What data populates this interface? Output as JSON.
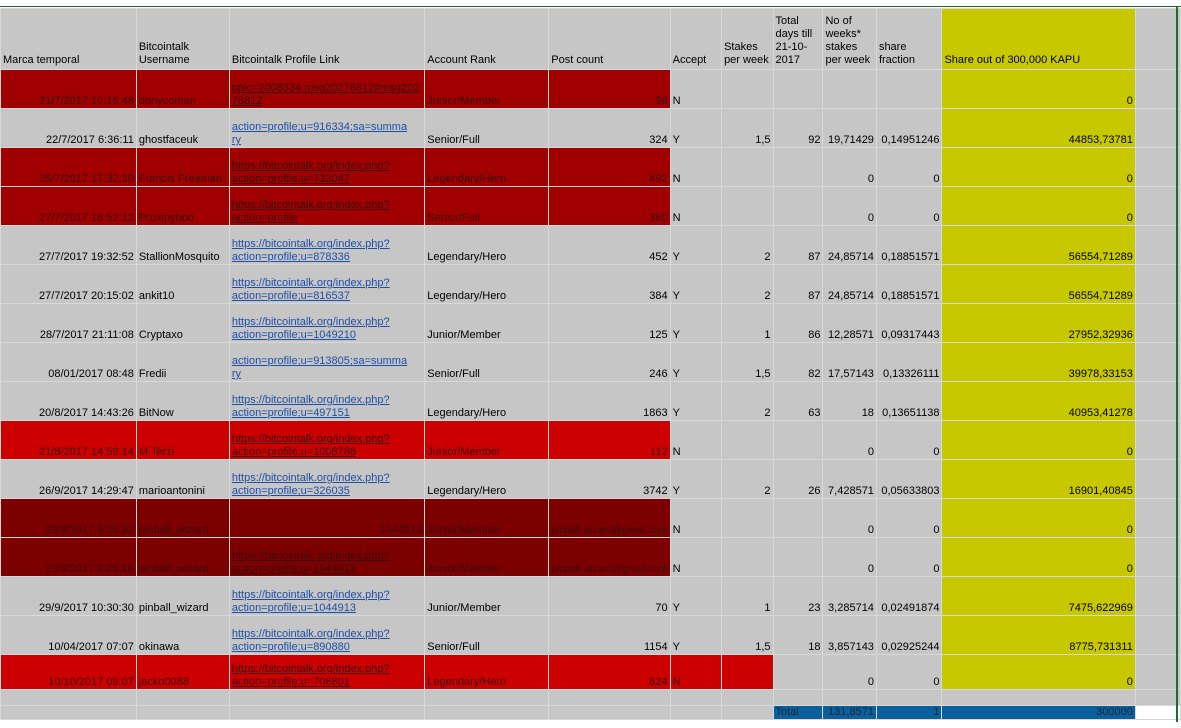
{
  "headers": {
    "timestamp": "Marca temporal",
    "username": "Bitcointalk Username",
    "profile": "Bitcointalk Profile Link",
    "rank": "Account Rank",
    "posts": "Post count",
    "accept": "Accept",
    "stakes": "Stakes per week",
    "days": "Total days till 21-10-2017",
    "weeks": "No of weeks* stakes per week",
    "fraction": "share fraction",
    "share": "Share out of 300,000 KAPU"
  },
  "rows": [
    {
      "ts": "21/7/2017 10:16:48",
      "user": "danycoman",
      "link1": "opic=2008334.msg20276812#msg202",
      "link2": "76812",
      "rank": "Junior/Member",
      "posts": "98",
      "accept": "N",
      "stakes": "",
      "days": "",
      "weeks": "",
      "fraction": "",
      "share": "0"
    },
    {
      "ts": "22/7/2017 6:36:11",
      "user": "ghostfaceuk",
      "link1": "action=profile;u=916334;sa=summa",
      "link2": "ry",
      "rank": "Senior/Full",
      "posts": "324",
      "accept": "Y",
      "stakes": "1,5",
      "days": "92",
      "weeks": "19,71429",
      "fraction": "0,14951246",
      "share": "44853,73781"
    },
    {
      "ts": "25/7/2017 17:32:39",
      "user": "Francis Freeman",
      "link1": "https://bitcointalk.org/index.php?",
      "link2": "action=profile;u=733047",
      "rank": "Legendary/Hero",
      "posts": "492",
      "accept": "N",
      "stakes": "",
      "days": "",
      "weeks": "0",
      "fraction": "0",
      "share": "0"
    },
    {
      "ts": "27/7/2017 18:52:12",
      "user": "Proxipyboo",
      "link1": "https://bitcointalk.org/index.php?",
      "link2": "action=profile",
      "rank": "Senior/Full",
      "posts": "360",
      "accept": "N",
      "stakes": "",
      "days": "",
      "weeks": "0",
      "fraction": "0",
      "share": "0"
    },
    {
      "ts": "27/7/2017 19:32:52",
      "user": "StallionMosquito",
      "link1": "https://bitcointalk.org/index.php?",
      "link2": "action=profile;u=878336",
      "rank": "Legendary/Hero",
      "posts": "452",
      "accept": "Y",
      "stakes": "2",
      "days": "87",
      "weeks": "24,85714",
      "fraction": "0,18851571",
      "share": "56554,71289"
    },
    {
      "ts": "27/7/2017 20:15:02",
      "user": "ankit10",
      "link1": "https://bitcointalk.org/index.php?",
      "link2": "action=profile;u=816537",
      "rank": "Legendary/Hero",
      "posts": "384",
      "accept": "Y",
      "stakes": "2",
      "days": "87",
      "weeks": "24,85714",
      "fraction": "0,18851571",
      "share": "56554,71289"
    },
    {
      "ts": "28/7/2017 21:11:08",
      "user": "Cryptaxo",
      "link1": "https://bitcointalk.org/index.php?",
      "link2": "action=profile;u=1049210",
      "rank": "Junior/Member",
      "posts": "125",
      "accept": "Y",
      "stakes": "1",
      "days": "86",
      "weeks": "12,28571",
      "fraction": "0,09317443",
      "share": "27952,32936"
    },
    {
      "ts": "08/01/2017 08:48",
      "user": "Fredii",
      "link1": "action=profile;u=913805;sa=summa",
      "link2": "ry",
      "rank": "Senior/Full",
      "posts": "246",
      "accept": "Y",
      "stakes": "1,5",
      "days": "82",
      "weeks": "17,57143",
      "fraction": "0,13326111",
      "share": "39978,33153"
    },
    {
      "ts": "20/8/2017 14:43:26",
      "user": "BitNow",
      "link1": "https://bitcointalk.org/index.php?",
      "link2": "action=profile;u=497151",
      "rank": "Legendary/Hero",
      "posts": "1863",
      "accept": "Y",
      "stakes": "2",
      "days": "63",
      "weeks": "18",
      "fraction": "0,13651138",
      "share": "40953,41278"
    },
    {
      "ts": "21/8/2017 14:59:14",
      "user": "M.Terzi",
      "link1": "https://bitcointalk.org/index.php?",
      "link2": "action=profile;u=1008788",
      "rank": "Junior/Member",
      "posts": "112",
      "accept": "N",
      "stakes": "",
      "days": "",
      "weeks": "0",
      "fraction": "0",
      "share": "0"
    },
    {
      "ts": "26/9/2017 14:29:47",
      "user": "marioantonini",
      "link1": "https://bitcointalk.org/index.php?",
      "link2": "action=profile;u=326035",
      "rank": "Legendary/Hero",
      "posts": "3742",
      "accept": "Y",
      "stakes": "2",
      "days": "26",
      "weeks": "7,428571",
      "fraction": "0,05633803",
      "share": "16901,40845"
    },
    {
      "ts": "29/9/2017 9:25:32",
      "user": "pinball_wizard",
      "link1": "",
      "link2": "",
      "linkval": "1044913",
      "rank": "Junior/Member",
      "posts": "",
      "email": "pinball.wizard@gmail.com",
      "accept": "N",
      "stakes": "",
      "days": "",
      "weeks": "0",
      "fraction": "0",
      "share": "0"
    },
    {
      "ts": "29/9/2017 9:26:10",
      "user": "pinball_wizard",
      "link1": "https://bitcointalk.org/index.php?",
      "link2": "action=profile;u=1044913",
      "rank": "Junior/Member",
      "posts": "",
      "email": "pinball.wizard@gmail.com",
      "accept": "N",
      "stakes": "",
      "days": "",
      "weeks": "0",
      "fraction": "0",
      "share": "0"
    },
    {
      "ts": "29/9/2017 10:30:30",
      "user": "pinball_wizard",
      "link1": "https://bitcointalk.org/index.php?",
      "link2": "action=profile;u=1044913",
      "rank": "Junior/Member",
      "posts": "70",
      "accept": "Y",
      "stakes": "1",
      "days": "23",
      "weeks": "3,285714",
      "fraction": "0,02491874",
      "share": "7475,622969"
    },
    {
      "ts": "10/04/2017 07:07",
      "user": "okinawa",
      "link1": "https://bitcointalk.org/index.php?",
      "link2": "action=profile;u=890880",
      "rank": "Senior/Full",
      "posts": "1154",
      "accept": "Y",
      "stakes": "1,5",
      "days": "18",
      "weeks": "3,857143",
      "fraction": "0,02925244",
      "share": "8775,731311"
    },
    {
      "ts": "10/10/2017 09:07",
      "user": "jacko0088",
      "link1": "https://bitcointalk.org/index.php?",
      "link2": "action=profile;u=706801",
      "rank": "Legendary/Hero",
      "posts": "824",
      "accept": "N",
      "stakes": "",
      "days": "",
      "weeks": "0",
      "fraction": "0",
      "share": "0"
    }
  ],
  "totals": {
    "label": "Total",
    "weeks": "131,8571",
    "fraction": "1",
    "share": "300000"
  }
}
